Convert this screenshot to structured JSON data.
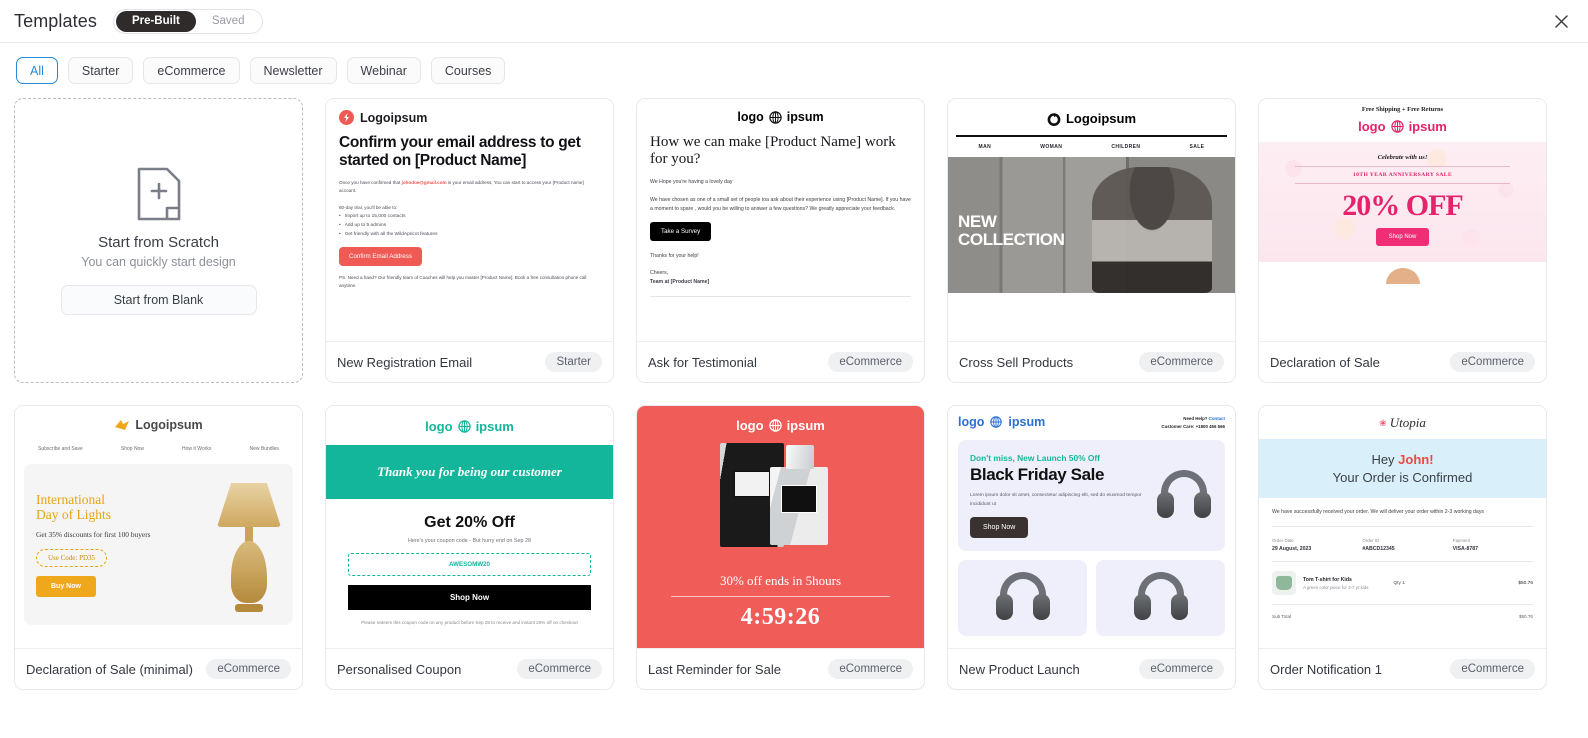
{
  "header": {
    "title": "Templates",
    "toggle": {
      "options": [
        "Pre-Built",
        "Saved"
      ],
      "active": "Pre-Built"
    },
    "close_label": "✕"
  },
  "filters": {
    "items": [
      "All",
      "Starter",
      "eCommerce",
      "Newsletter",
      "Webinar",
      "Courses"
    ],
    "active": "All"
  },
  "annotation": {
    "type": "red-arrow",
    "color": "#ff0000",
    "points": "left"
  },
  "blank_card": {
    "title": "Start from Scratch",
    "subtitle": "You can quickly start design",
    "button": "Start from Blank"
  },
  "templates": [
    {
      "name": "New Registration Email",
      "badge": "Starter",
      "logo": "Logoipsum",
      "heading": "Confirm your email address to get started on [Product Name]",
      "intro_pre": "Once you have confirmed that ",
      "intro_email": "johndoe@gmail.com",
      "intro_post": " is  your email address, You can start to access your [Product name] account.",
      "list_title": "60-day trial, you'll be able to:",
      "bullets": [
        "Import up to 15,000 contacts",
        "Add up to 5 admins",
        "Get friendly with all the WildApricot features"
      ],
      "cta": "Confirm Email Address",
      "ps": "PS. Need a hand? Our friendly team of Coaches will help you master [Product Name]. Book a free consultation phone call anytime."
    },
    {
      "name": "Ask for Testimonial",
      "badge": "eCommerce",
      "logo_left": "logo",
      "logo_right": "ipsum",
      "heading": "How we can make [Product Name] work for you?",
      "greeting": "We Hope you're having a lovely day",
      "body": "We have chosen as one of a small set of people toa ask about their  experience using [Product Name]. If you have a moment to spare , would you be willing to answer a few questions? We greatly appreciate your feedback.",
      "cta": "Take a Survey",
      "thanks": "Thanks for your help!",
      "signoff": "Cheers,",
      "team": "Team at [Product Name]"
    },
    {
      "name": "Cross Sell Products",
      "badge": "eCommerce",
      "logo": "Logoipsum",
      "nav": [
        "MAN",
        "WOMAN",
        "CHILDREN",
        "SALE"
      ],
      "hero_line1": "NEW",
      "hero_line2": "COLLECTION"
    },
    {
      "name": "Declaration of Sale",
      "badge": "eCommerce",
      "topbar": "Free Shipping  +  Free Returns",
      "logo_left": "logo",
      "logo_right": "ipsum",
      "celebrate": "Celebrate with us!",
      "anniversary": "10TH YEAR ANNIVERSARY SALE",
      "offer": "20% OFF",
      "cta": "Shop Now"
    },
    {
      "name": "Declaration of Sale (minimal)",
      "badge": "eCommerce",
      "logo": "Logoipsum",
      "nav": [
        "Subscribe and Save",
        "Shop Now",
        "How it Works",
        "New Bundles"
      ],
      "heading_l1": "International",
      "heading_l2": "Day of Lights",
      "body": "Get 35% discounts for first 100 buyers",
      "code": "Use Code: PD35",
      "cta": "Buy Now"
    },
    {
      "name": "Personalised Coupon",
      "badge": "eCommerce",
      "logo_left": "logo",
      "logo_right": "ipsum",
      "band": "Thank you for being our customer",
      "heading": "Get 20% Off",
      "sub": "Here's your coupon code - But hurry end on  Sep 28",
      "code": "AWESOMW20",
      "cta": "Shop Now",
      "foot": "Please redeem this coupon code on any product before Sep 28 to receive and instant 20% off on checkout"
    },
    {
      "name": "Last Reminder for Sale",
      "badge": "eCommerce",
      "logo_left": "logo",
      "logo_right": "ipsum",
      "offer": "30% off ends in 5hours",
      "countdown": "4:59:26",
      "bg_color": "#f05c58"
    },
    {
      "name": "New Product Launch",
      "badge": "eCommerce",
      "logo_left": "logo",
      "logo_right": "ipsum",
      "help_line1_pre": "Need Help? ",
      "help_link": "Contact",
      "help_line2": "Customer Care: +1800 456 566",
      "kicker": "Don't miss, New Launch 50% Off",
      "heading": "Black Friday Sale",
      "body": "Lorem ipsum dolor sit amet, consectetur adipiscing elit, sed do eiusmod tempor incididunt ut",
      "cta": "Shop Now"
    },
    {
      "name": "Order Notification 1",
      "badge": "eCommerce",
      "brand": "Utopia",
      "hey_pre": "Hey ",
      "hey_name": "John!",
      "confirm": "Your Order is Confirmed",
      "body": "We have successfully received your order. We will deliver your order within 2-3 working days",
      "meta": [
        {
          "label": "Order Date",
          "value": "29 August, 2023"
        },
        {
          "label": "Order ID",
          "value": "#ABCD12345"
        },
        {
          "label": "Payment",
          "value": "VISA-8787"
        }
      ],
      "item_name": "Tom T-shirt for Kids",
      "item_desc": "A green color piece for 3-7 yr kids",
      "item_qty": "Qty 1",
      "item_price": "$50.76",
      "subtotal_label": "Sub Total",
      "subtotal_value": "$50.76"
    }
  ]
}
